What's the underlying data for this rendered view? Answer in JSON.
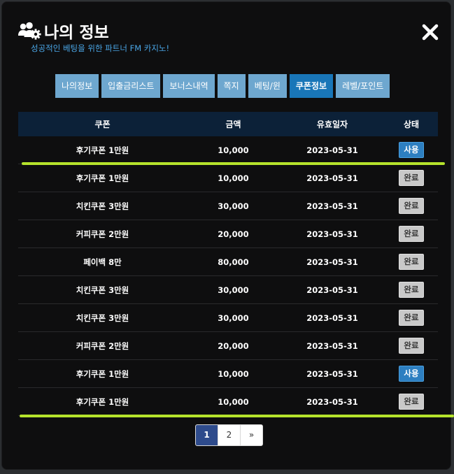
{
  "header": {
    "title": "나의 정보",
    "subtitle": "성공적인 베팅을 위한 파트너 FM 카지노!",
    "icon": "users-gear-icon",
    "close_icon": "close-icon"
  },
  "tabs": [
    {
      "label": "나의정보",
      "active": false
    },
    {
      "label": "입출금리스트",
      "active": false
    },
    {
      "label": "보너스내역",
      "active": false
    },
    {
      "label": "쪽지",
      "active": false
    },
    {
      "label": "베팅/윈",
      "active": false
    },
    {
      "label": "쿠폰정보",
      "active": true
    },
    {
      "label": "레벨/포인트",
      "active": false
    }
  ],
  "table": {
    "headers": [
      "쿠폰",
      "금액",
      "유효일자",
      "상태"
    ],
    "rows": [
      {
        "coupon": "후기쿠폰 1만원",
        "amount": "10,000",
        "expiry": "2023-05-31",
        "status": "사용",
        "status_type": "used"
      },
      {
        "coupon": "후기쿠폰 1만원",
        "amount": "10,000",
        "expiry": "2023-05-31",
        "status": "완료",
        "status_type": "done"
      },
      {
        "coupon": "치킨쿠폰 3만원",
        "amount": "30,000",
        "expiry": "2023-05-31",
        "status": "완료",
        "status_type": "done"
      },
      {
        "coupon": "커피쿠폰 2만원",
        "amount": "20,000",
        "expiry": "2023-05-31",
        "status": "완료",
        "status_type": "done"
      },
      {
        "coupon": "페이백 8만",
        "amount": "80,000",
        "expiry": "2023-05-31",
        "status": "완료",
        "status_type": "done"
      },
      {
        "coupon": "치킨쿠폰 3만원",
        "amount": "30,000",
        "expiry": "2023-05-31",
        "status": "완료",
        "status_type": "done"
      },
      {
        "coupon": "치킨쿠폰 3만원",
        "amount": "30,000",
        "expiry": "2023-05-31",
        "status": "완료",
        "status_type": "done"
      },
      {
        "coupon": "커피쿠폰 2만원",
        "amount": "20,000",
        "expiry": "2023-05-31",
        "status": "완료",
        "status_type": "done"
      },
      {
        "coupon": "후기쿠폰 1만원",
        "amount": "10,000",
        "expiry": "2023-05-31",
        "status": "사용",
        "status_type": "used"
      },
      {
        "coupon": "후기쿠폰 1만원",
        "amount": "10,000",
        "expiry": "2023-05-31",
        "status": "완료",
        "status_type": "done"
      }
    ]
  },
  "pagination": {
    "pages": [
      "1",
      "2"
    ],
    "current": "1",
    "next": "»"
  },
  "colors": {
    "accent": "#1976b8",
    "highlight_line": "#b5e32c",
    "subtitle": "#4aa6e6"
  }
}
